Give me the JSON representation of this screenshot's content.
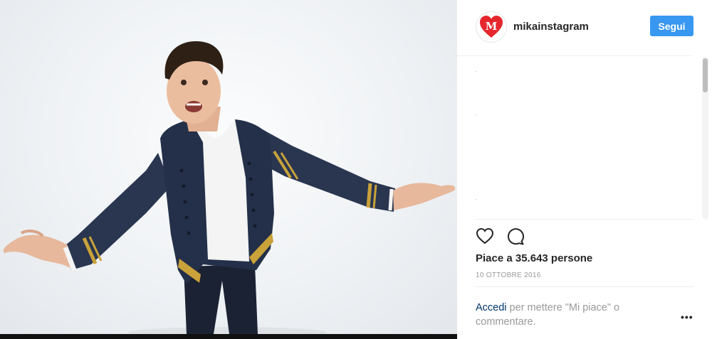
{
  "post": {
    "username": "mikainstagram",
    "follow_label": "Segui",
    "likes_text": "Piace a 35.643 persone",
    "date": "10 OTTOBRE 2016",
    "login_link": "Accedi",
    "login_rest": " per mettere \"Mi piace\" o commentare.",
    "avatar_letter": "M"
  },
  "colors": {
    "accent": "#3897f0",
    "avatar_heart": "#e5272d",
    "link": "#003569"
  },
  "icons": {
    "like": "heart-outline-icon",
    "comment": "speech-bubble-icon",
    "more": "ellipsis-icon"
  }
}
